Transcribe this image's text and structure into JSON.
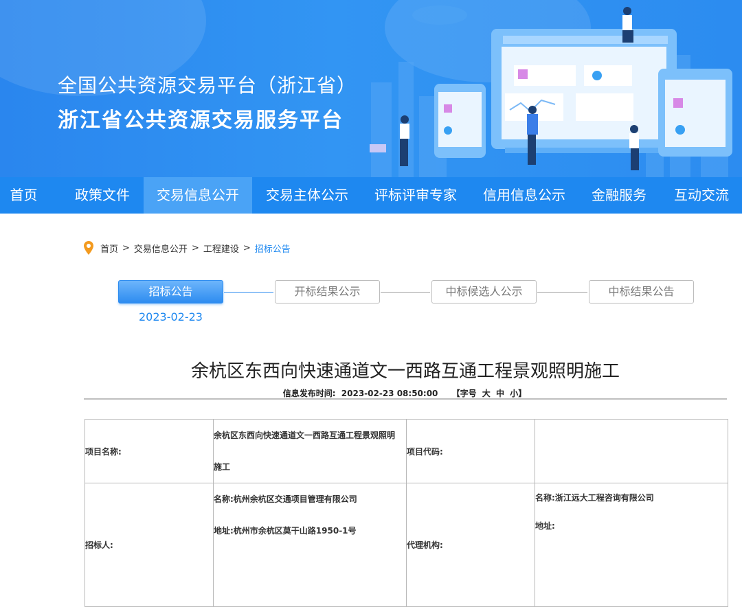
{
  "banner": {
    "title_line1": "全国公共资源交易平台（浙江省）",
    "title_line2": "浙江省公共资源交易服务平台"
  },
  "nav": {
    "items": [
      "首页",
      "政策文件",
      "交易信息公开",
      "交易主体公示",
      "评标评审专家",
      "信用信息公示",
      "金融服务",
      "互动交流"
    ],
    "active_index": 2
  },
  "breadcrumb": {
    "items": [
      "首页",
      "交易信息公开",
      "工程建设",
      "招标公告"
    ],
    "separator": ">"
  },
  "steps": {
    "items": [
      "招标公告",
      "开标结果公示",
      "中标候选人公示",
      "中标结果公告"
    ],
    "active_index": 0,
    "active_date": "2023-02-23"
  },
  "article": {
    "title": "余杭区东西向快速通道文一西路互通工程景观照明施工",
    "publish_label": "信息发布时间:",
    "publish_time": "2023-02-23 08:50:00",
    "font_size_label_open": "【字号",
    "font_size_large": "大",
    "font_size_medium": "中",
    "font_size_small": "小】"
  },
  "table": {
    "row1": {
      "key1": "项目名称:",
      "val1_line1": "余杭区东西向快速通道文一西路互通工程景观照明",
      "val1_line2": "施工",
      "key2": "项目代码:",
      "val2": ""
    },
    "row2": {
      "key1": "招标人:",
      "val1_name": "名称:杭州余杭区交通项目管理有限公司",
      "val1_addr": "地址:杭州市余杭区莫干山路1950-1号",
      "key2": "代理机构:",
      "val2_name": "名称:浙江远大工程咨询有限公司",
      "val2_addr": "地址:"
    }
  },
  "colors": {
    "banner_bg": "#2f8ff0",
    "nav_bg": "#1e88f0",
    "nav_active": "#4aa3f6",
    "link_blue": "#1e88f0",
    "pin_orange": "#f39a1e"
  }
}
